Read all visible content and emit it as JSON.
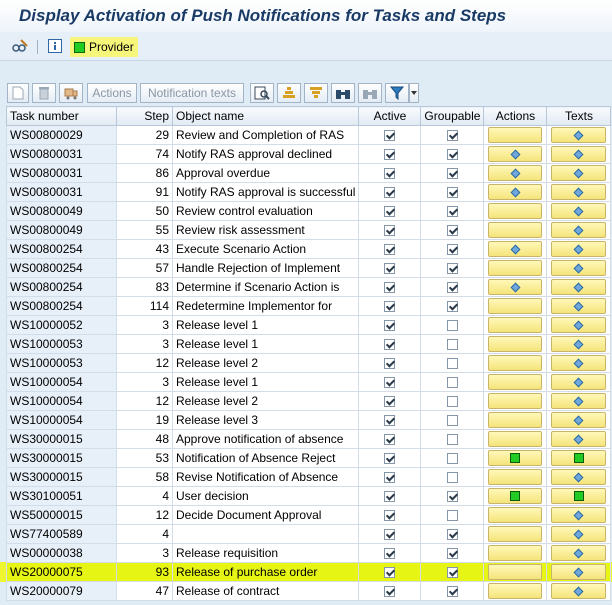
{
  "window": {
    "title": "Display Activation of Push Notifications for Tasks and Steps"
  },
  "toolbar": {
    "edit_icon": "glasses-pencil-icon",
    "info_icon": "info-icon",
    "provider_label": "Provider"
  },
  "grid_toolbar": {
    "actions_label": "Actions",
    "notification_texts_label": "Notification texts"
  },
  "columns": {
    "task_number": "Task number",
    "step": "Step",
    "object_name": "Object name",
    "active": "Active",
    "groupable": "Groupable",
    "actions": "Actions",
    "texts": "Texts"
  },
  "rows": [
    {
      "task": "WS00800029",
      "step": "29",
      "name": "Review and Completion of RAS",
      "active": true,
      "group": true,
      "actions": "",
      "texts": "diamond"
    },
    {
      "task": "WS00800031",
      "step": "74",
      "name": "Notify RAS approval declined",
      "active": true,
      "group": true,
      "actions": "diamond",
      "texts": "diamond"
    },
    {
      "task": "WS00800031",
      "step": "86",
      "name": "Approval overdue",
      "active": true,
      "group": true,
      "actions": "diamond",
      "texts": "diamond"
    },
    {
      "task": "WS00800031",
      "step": "91",
      "name": "Notify RAS approval is successful",
      "active": true,
      "group": true,
      "actions": "diamond",
      "texts": "diamond"
    },
    {
      "task": "WS00800049",
      "step": "50",
      "name": "Review control evaluation",
      "active": true,
      "group": true,
      "actions": "",
      "texts": "diamond"
    },
    {
      "task": "WS00800049",
      "step": "55",
      "name": "Review risk assessment",
      "active": true,
      "group": true,
      "actions": "",
      "texts": "diamond"
    },
    {
      "task": "WS00800254",
      "step": "43",
      "name": "Execute Scenario Action",
      "active": true,
      "group": true,
      "actions": "diamond",
      "texts": "diamond"
    },
    {
      "task": "WS00800254",
      "step": "57",
      "name": "Handle Rejection of Implement",
      "active": true,
      "group": true,
      "actions": "",
      "texts": "diamond"
    },
    {
      "task": "WS00800254",
      "step": "83",
      "name": "Determine if Scenario Action is",
      "active": true,
      "group": true,
      "actions": "diamond",
      "texts": "diamond"
    },
    {
      "task": "WS00800254",
      "step": "114",
      "name": "Redetermine Implementor for",
      "active": true,
      "group": true,
      "actions": "",
      "texts": "diamond"
    },
    {
      "task": "WS10000052",
      "step": "3",
      "name": "Release level 1",
      "active": true,
      "group": false,
      "actions": "",
      "texts": "diamond"
    },
    {
      "task": "WS10000053",
      "step": "3",
      "name": "Release level 1",
      "active": true,
      "group": false,
      "actions": "",
      "texts": "diamond"
    },
    {
      "task": "WS10000053",
      "step": "12",
      "name": "Release level 2",
      "active": true,
      "group": false,
      "actions": "",
      "texts": "diamond"
    },
    {
      "task": "WS10000054",
      "step": "3",
      "name": "Release level 1",
      "active": true,
      "group": false,
      "actions": "",
      "texts": "diamond"
    },
    {
      "task": "WS10000054",
      "step": "12",
      "name": "Release level 2",
      "active": true,
      "group": false,
      "actions": "",
      "texts": "diamond"
    },
    {
      "task": "WS10000054",
      "step": "19",
      "name": "Release level 3",
      "active": true,
      "group": false,
      "actions": "",
      "texts": "diamond"
    },
    {
      "task": "WS30000015",
      "step": "48",
      "name": "Approve notification of absence",
      "active": true,
      "group": false,
      "actions": "",
      "texts": "diamond"
    },
    {
      "task": "WS30000015",
      "step": "53",
      "name": "Notification of Absence Reject",
      "active": true,
      "group": false,
      "actions": "green",
      "texts": "green"
    },
    {
      "task": "WS30000015",
      "step": "58",
      "name": "Revise Notification of Absence",
      "active": true,
      "group": false,
      "actions": "",
      "texts": "diamond"
    },
    {
      "task": "WS30100051",
      "step": "4",
      "name": "User decision",
      "active": true,
      "group": true,
      "actions": "green",
      "texts": "green"
    },
    {
      "task": "WS50000015",
      "step": "12",
      "name": "Decide Document Approval",
      "active": true,
      "group": false,
      "actions": "",
      "texts": "diamond"
    },
    {
      "task": "WS77400589",
      "step": "4",
      "name": "",
      "active": true,
      "group": true,
      "actions": "",
      "texts": "diamond"
    },
    {
      "task": "WS00000038",
      "step": "3",
      "name": "Release requisition",
      "active": true,
      "group": true,
      "actions": "",
      "texts": "diamond"
    },
    {
      "task": "WS20000075",
      "step": "93",
      "name": "Release of purchase order",
      "active": true,
      "group": true,
      "actions": "",
      "texts": "diamond",
      "highlight": true
    },
    {
      "task": "WS20000079",
      "step": "47",
      "name": "Release of contract",
      "active": true,
      "group": true,
      "actions": "",
      "texts": "diamond"
    }
  ]
}
